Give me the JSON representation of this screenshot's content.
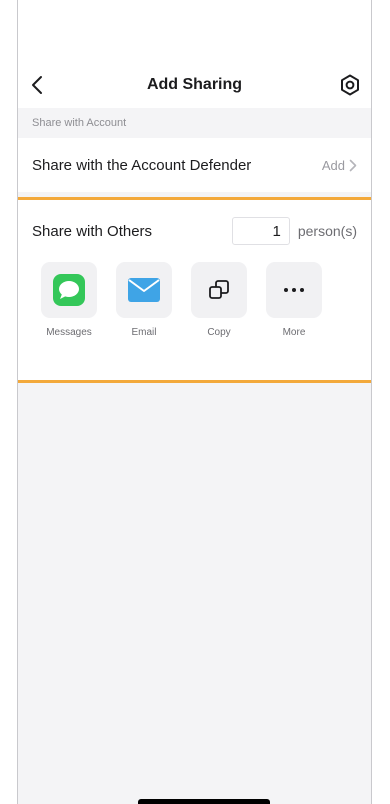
{
  "header": {
    "title": "Add Sharing"
  },
  "account_section": {
    "header": "Share with Account",
    "row_label": "Share with the Account Defender",
    "action_label": "Add"
  },
  "others_section": {
    "label": "Share with Others",
    "count_value": "1",
    "count_unit": "person(s)",
    "options": [
      {
        "label": "Messages",
        "icon": "messages-icon"
      },
      {
        "label": "Email",
        "icon": "email-icon"
      },
      {
        "label": "Copy",
        "icon": "copy-icon"
      },
      {
        "label": "More",
        "icon": "more-icon"
      }
    ]
  },
  "colors": {
    "highlight": "#f3a93b",
    "messages_green": "#34c759",
    "email_blue": "#3fa4e6"
  }
}
